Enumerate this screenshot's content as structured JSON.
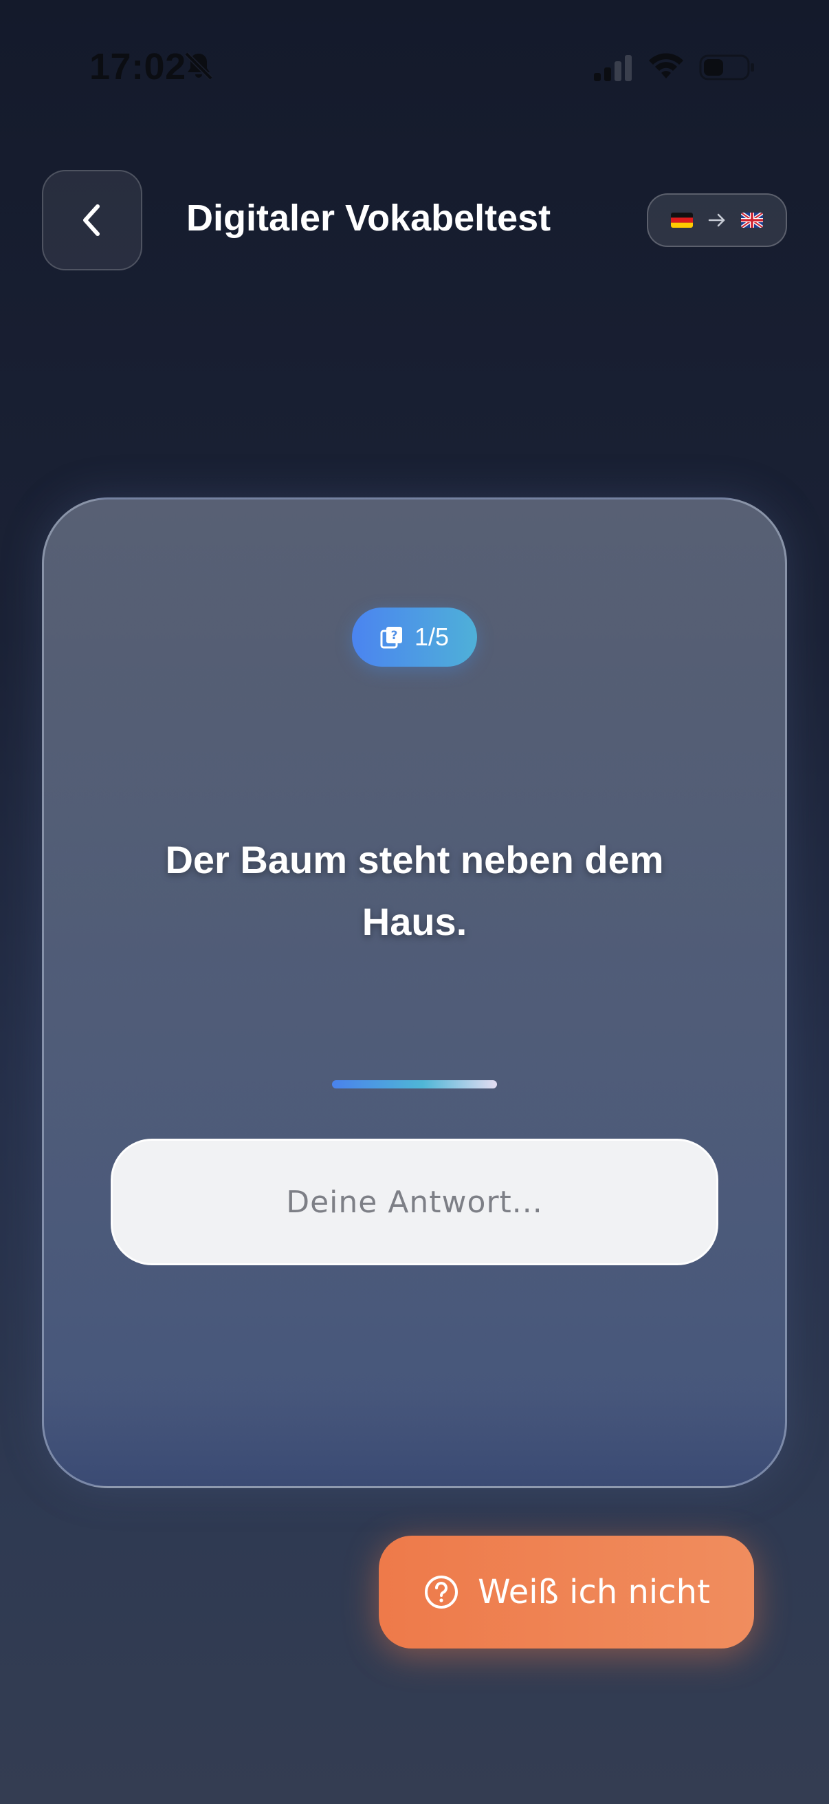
{
  "status_bar": {
    "time": "17:02",
    "icons": [
      "bell-muted-icon",
      "cellular-signal-icon",
      "wifi-icon",
      "battery-icon"
    ]
  },
  "header": {
    "back_icon": "chevron-left-icon",
    "title": "Digitaler Vokabeltest",
    "language_pair": {
      "from_flag": "flag-germany-icon",
      "arrow_icon": "arrow-right-icon",
      "to_flag": "flag-uk-icon"
    }
  },
  "card": {
    "badge": {
      "icon": "flashcard-question-icon",
      "text": "1/5"
    },
    "question": "Der Baum steht neben dem Haus.",
    "answer": {
      "value": "",
      "placeholder": "Deine Antwort..."
    }
  },
  "actions": {
    "dont_know_icon": "question-circle-icon",
    "dont_know_label": "Weiß ich nicht"
  },
  "colors": {
    "accent_blue": "#4b84f0",
    "accent_teal": "#4fb0d8",
    "accent_orange": "#ee7a4a"
  }
}
